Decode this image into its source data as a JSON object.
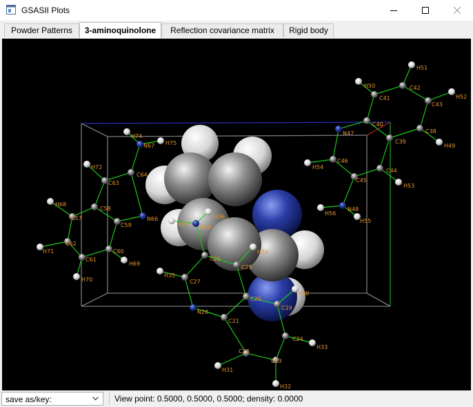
{
  "window": {
    "title": "GSASII Plots",
    "icon": "app-icon",
    "controls": [
      "minimize-icon",
      "maximize-icon",
      "close-icon"
    ]
  },
  "tabs": [
    {
      "label": "Powder Patterns",
      "active": false
    },
    {
      "label": "3-aminoquinolone",
      "active": true
    },
    {
      "label": "Reflection covariance matrix",
      "active": false
    },
    {
      "label": "Rigid body",
      "active": false
    }
  ],
  "status": {
    "save_label": "save as/key:",
    "view_text": "View point: 0.5000, 0.5000, 0.5000; density: 0.0000"
  },
  "colors": {
    "background": "#000000",
    "carbon": "#8c8c8c",
    "nitrogen": "#2a3fa8",
    "hydrogen": "#e6e6e6",
    "bond": "#1ec81e",
    "label": "#e8952f",
    "cell": "#7a7a7a"
  },
  "atom_labels": {
    "H74": "H74",
    "H75": "H75",
    "N67": "N67",
    "H72": "H72",
    "C64": "C64",
    "C63": "C63",
    "H68": "H68",
    "C58": "C58",
    "C57": "C57",
    "N66": "N66",
    "C59": "C59",
    "C62": "C62",
    "H71": "H71",
    "C60": "C60",
    "C61": "C61",
    "H69": "H69",
    "H70": "H70",
    "H51": "H51",
    "H50": "H50",
    "C42": "C42",
    "C41": "C41",
    "C43": "C43",
    "H52": "H52",
    "C40": "C40",
    "N47": "N47",
    "C38": "C38",
    "C39": "C39",
    "H49": "H49",
    "H54": "H54",
    "C46": "C46",
    "C44": "C44",
    "C45": "C45",
    "H53": "H53",
    "N48": "N48",
    "H56": "H56",
    "H55": "H55",
    "H37": "H37",
    "N29": "N29",
    "H36": "H36",
    "H34": "H34",
    "C26": "C26",
    "C25": "C25",
    "H35": "H35",
    "C27": "C27",
    "C20": "C20",
    "H30": "H30",
    "C19": "C19",
    "N28": "N28",
    "C21": "C21",
    "C24": "C24",
    "H33": "H33",
    "C22": "C22",
    "C23": "C23",
    "H31": "H31",
    "H32": "H32"
  }
}
